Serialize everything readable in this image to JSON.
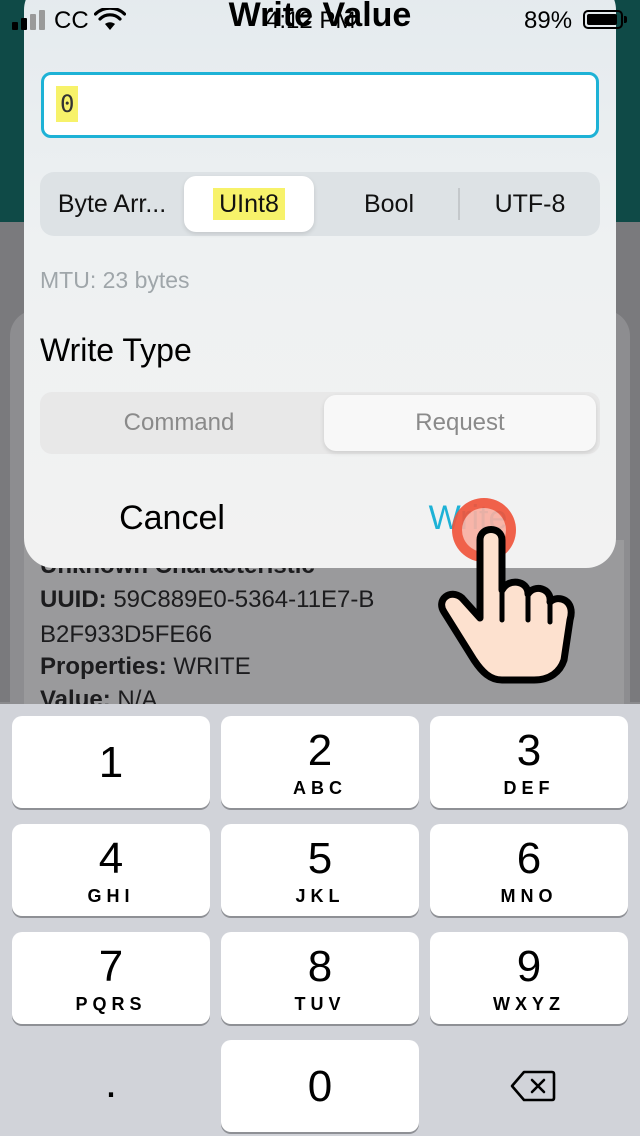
{
  "status_bar": {
    "carrier": "CC",
    "time": "4:12 PM",
    "battery_percent": "89%"
  },
  "dialog": {
    "title": "Write Value",
    "input_value": "0",
    "data_types": {
      "options": [
        "Byte Arr...",
        "UInt8",
        "Bool",
        "UTF-8"
      ],
      "selected": "UInt8"
    },
    "mtu": "MTU: 23 bytes",
    "write_type_label": "Write Type",
    "write_types": {
      "options": [
        "Command",
        "Request"
      ],
      "selected": "Request"
    },
    "cancel_label": "Cancel",
    "write_label": "Write"
  },
  "background": {
    "characteristic_name": "Unknown Characteristic",
    "uuid_label": "UUID:",
    "uuid_value": "59C889E0-5364-11E7-B",
    "uuid_value_cont": "B2F933D5FE66",
    "properties_label": "Properties:",
    "properties_value": "WRITE",
    "value_label": "Value:",
    "value_value": "N/A"
  },
  "keyboard": {
    "keys": [
      {
        "num": "1",
        "sub": ""
      },
      {
        "num": "2",
        "sub": "ABC"
      },
      {
        "num": "3",
        "sub": "DEF"
      },
      {
        "num": "4",
        "sub": "GHI"
      },
      {
        "num": "5",
        "sub": "JKL"
      },
      {
        "num": "6",
        "sub": "MNO"
      },
      {
        "num": "7",
        "sub": "PQRS"
      },
      {
        "num": "8",
        "sub": "TUV"
      },
      {
        "num": "9",
        "sub": "WXYZ"
      }
    ],
    "decimal": ".",
    "zero": "0",
    "delete_icon": "backspace-icon"
  },
  "colors": {
    "accent": "#1eb2d6",
    "highlight": "#f7f26a",
    "tap_indicator": "#f0553c"
  }
}
